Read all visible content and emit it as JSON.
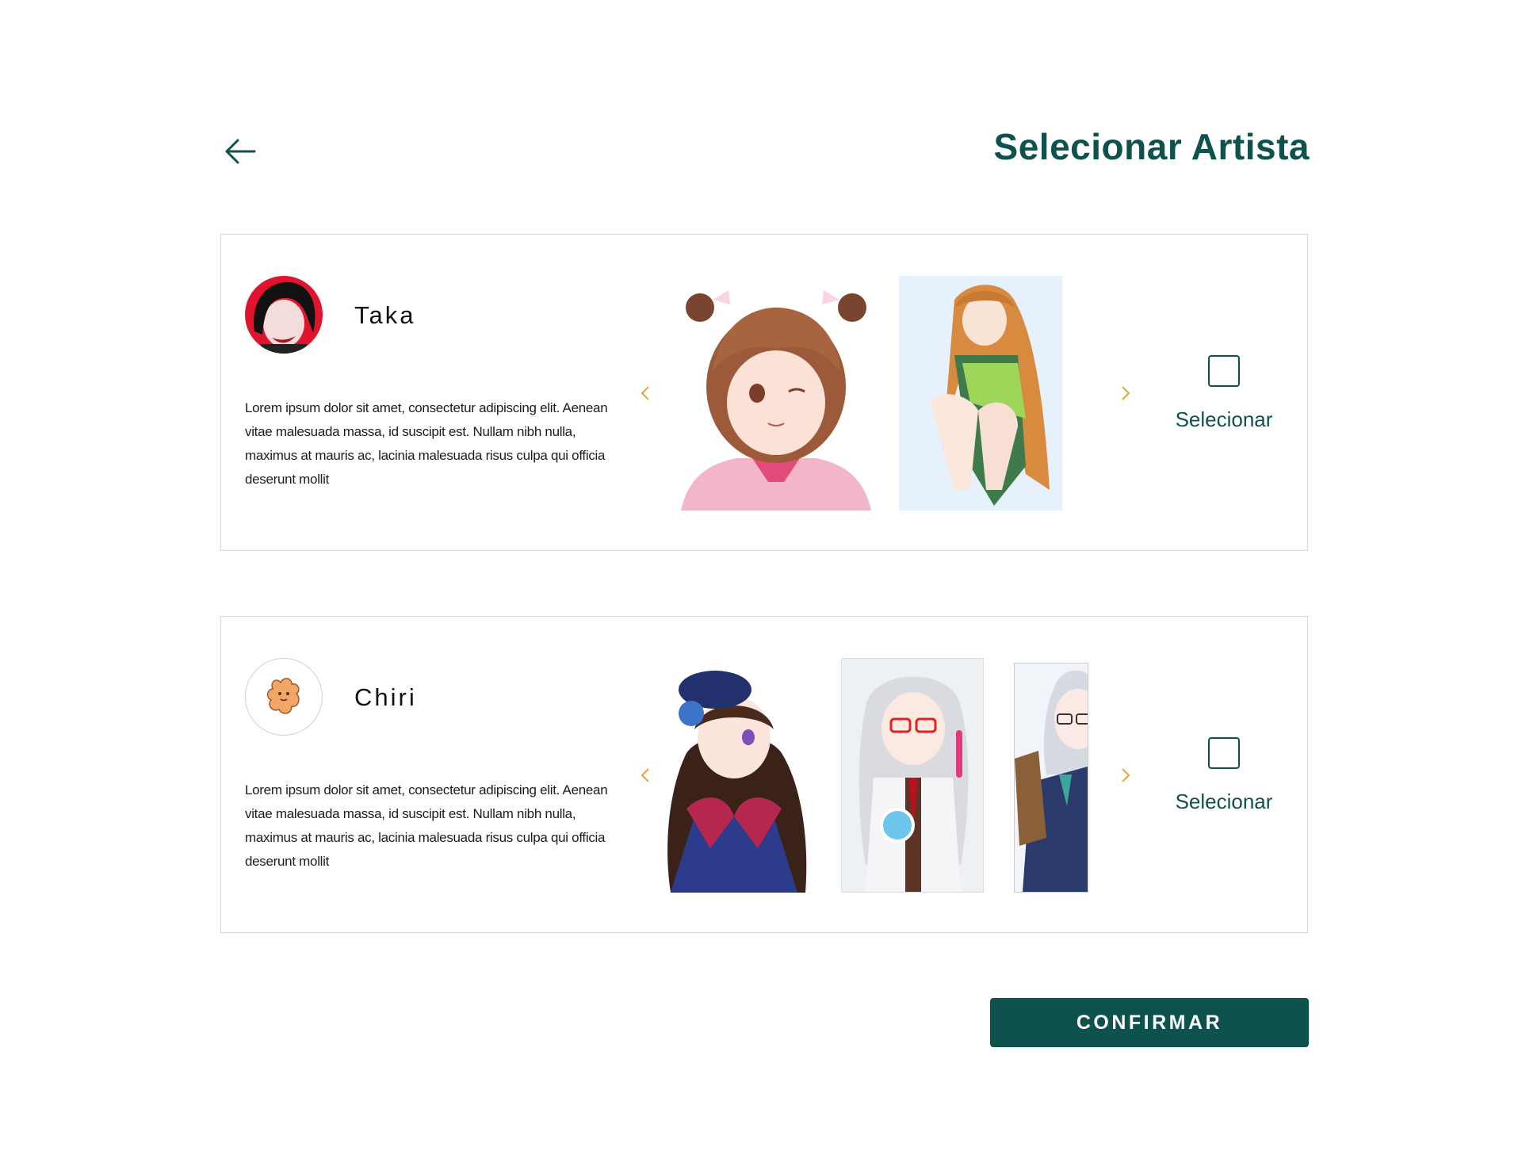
{
  "header": {
    "back_icon": "arrow-left-icon",
    "title": "Selecionar Artista"
  },
  "colors": {
    "primary": "#0e524d",
    "arrow": "#e9a23b",
    "border": "#d6d6d6"
  },
  "artists": [
    {
      "name": "Taka",
      "description": "Lorem ipsum dolor sit amet, consectetur adipiscing elit. Aenean vitae malesuada massa, id suscipit est. Nullam nibh nulla, maximus at mauris ac, lacinia malesuada risus culpa qui officia deserunt mollit",
      "select_label": "Selecionar",
      "selected": false,
      "gallery_count": 2
    },
    {
      "name": "Chiri",
      "description": "Lorem ipsum dolor sit amet, consectetur adipiscing elit. Aenean vitae malesuada massa, id suscipit est. Nullam nibh nulla, maximus at mauris ac, lacinia malesuada risus culpa qui officia deserunt mollit",
      "select_label": "Selecionar",
      "selected": false,
      "gallery_count": 3
    }
  ],
  "icons": {
    "prev": "chevron-left-icon",
    "next": "chevron-right-icon"
  },
  "footer": {
    "confirm_label": "CONFIRMAR"
  }
}
